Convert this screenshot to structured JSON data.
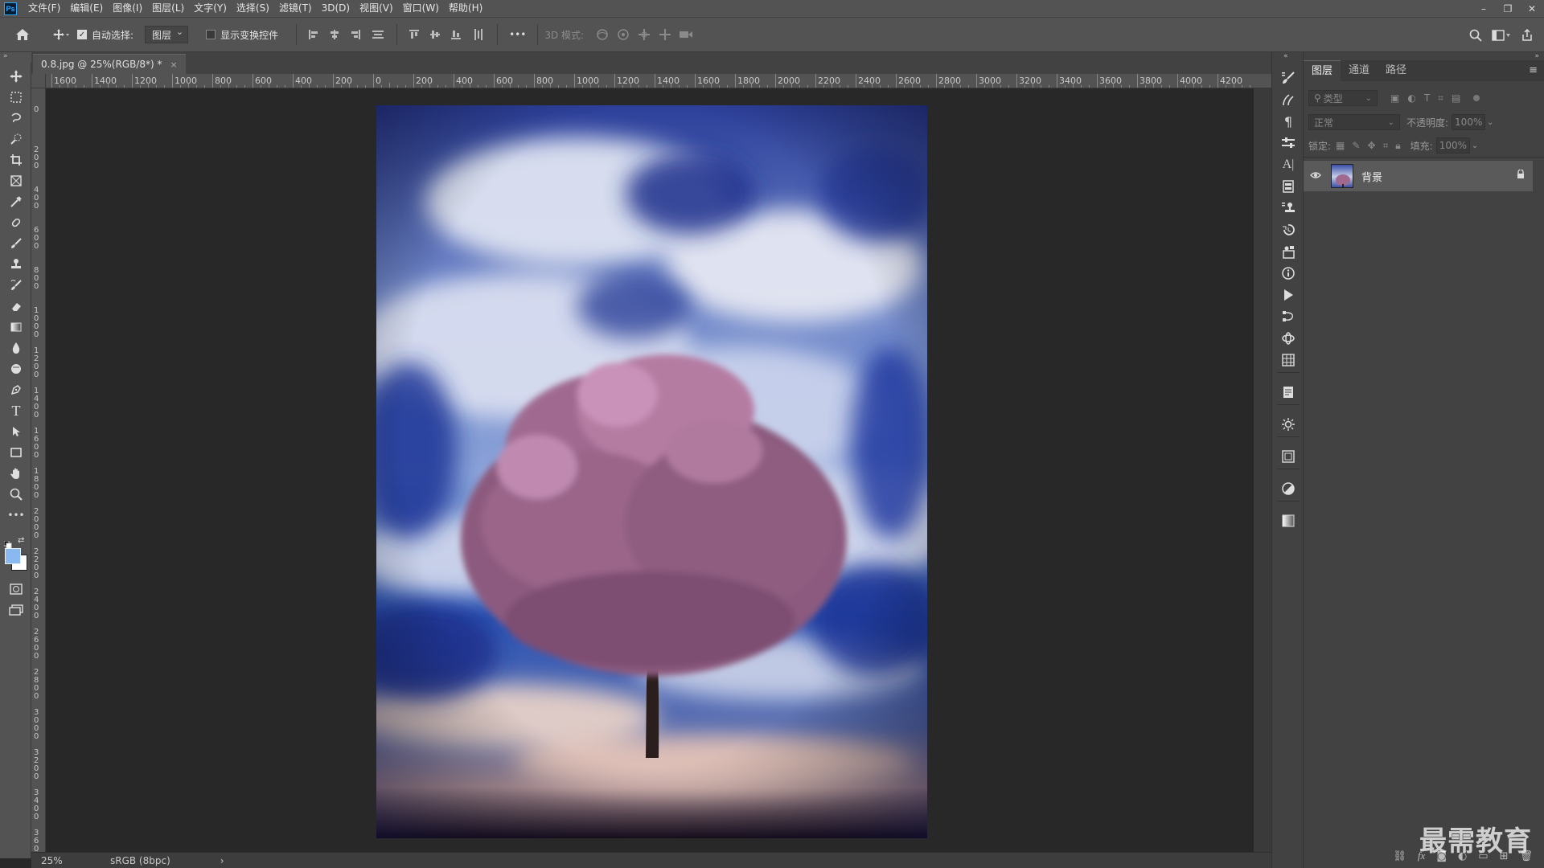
{
  "app": {
    "logo": "Ps"
  },
  "menu": [
    "文件(F)",
    "编辑(E)",
    "图像(I)",
    "图层(L)",
    "文字(Y)",
    "选择(S)",
    "滤镜(T)",
    "3D(D)",
    "视图(V)",
    "窗口(W)",
    "帮助(H)"
  ],
  "window_controls": {
    "minimize": "–",
    "restore": "❐",
    "close": "✕"
  },
  "options": {
    "auto_select_label": "自动选择:",
    "auto_select_checked": true,
    "auto_select_target": "图层",
    "show_transform_label": "显示变换控件",
    "mode_3d_label": "3D 模式:",
    "more": "•••"
  },
  "document": {
    "tab_title": "0.8.jpg @ 25%(RGB/8*) *",
    "close": "×"
  },
  "ruler_h_labels": [
    "1600",
    "1400",
    "1200",
    "1000",
    "800",
    "600",
    "400",
    "200",
    "0",
    "200",
    "400",
    "600",
    "800",
    "1000",
    "1200",
    "1400",
    "1600",
    "1800",
    "2000",
    "2200",
    "2400",
    "2600",
    "2800",
    "3000",
    "3200",
    "3400",
    "3600",
    "3800",
    "4000",
    "4200"
  ],
  "ruler_v_labels": [
    "0",
    "200",
    "400",
    "600",
    "800",
    "1000",
    "1200",
    "1400",
    "1600",
    "1800",
    "2000",
    "2200",
    "2400",
    "2600",
    "2800",
    "3000",
    "3200",
    "3400",
    "3600"
  ],
  "status": {
    "zoom": "25%",
    "color_profile": "sRGB (8bpc)",
    "arrow": "›"
  },
  "panel": {
    "tabs": [
      "图层",
      "通道",
      "路径"
    ],
    "active_tab": "图层",
    "filter_placeholder": "类型",
    "blend_mode": "正常",
    "opacity_label": "不透明度:",
    "opacity_value": "100%",
    "lock_label": "锁定:",
    "fill_label": "填充:",
    "fill_value": "100%",
    "layers": [
      {
        "name": "背景",
        "visible": true,
        "locked": true
      }
    ]
  },
  "watermark": "最需教育",
  "colors": {
    "foreground": "#8ab8f0",
    "background": "#ffffff",
    "tab_accent": "#31a8ff"
  }
}
